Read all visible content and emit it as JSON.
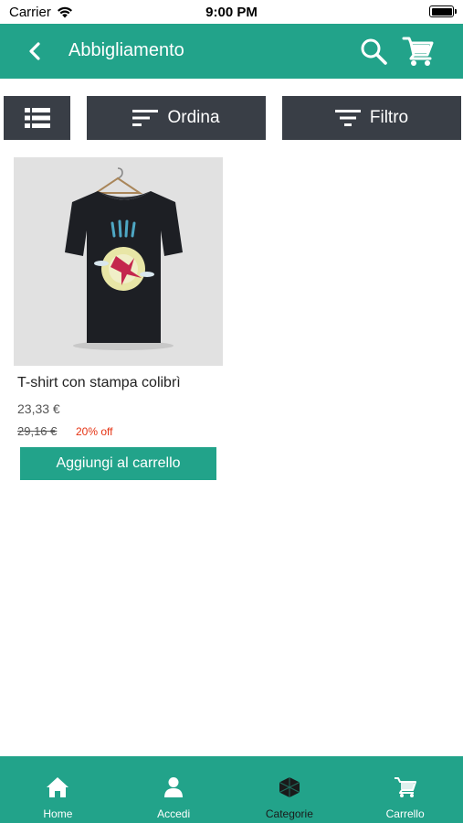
{
  "status_bar": {
    "carrier": "Carrier",
    "time": "9:00 PM"
  },
  "app_bar": {
    "title": "Abbigliamento",
    "back_icon": "chevron-left-icon",
    "search_icon": "search-icon",
    "cart_icon": "cart-icon"
  },
  "toolbar": {
    "view_icon": "list-view-icon",
    "sort_label": "Ordina",
    "filter_label": "Filtro"
  },
  "products": [
    {
      "name": "T-shirt con stampa colibrì",
      "price": "23,33 €",
      "old_price": "29,16 €",
      "discount": "20% off",
      "add_to_cart_label": "Aggiungi al carrello"
    }
  ],
  "bottom_nav": {
    "items": [
      {
        "label": "Home",
        "icon": "home-icon"
      },
      {
        "label": "Accedi",
        "icon": "user-icon"
      },
      {
        "label": "Categorie",
        "icon": "cube-icon",
        "active": true
      },
      {
        "label": "Carrello",
        "icon": "cart-icon"
      }
    ]
  },
  "colors": {
    "primary": "#22a38a",
    "toolbar": "#393e46",
    "discount": "#e53212"
  }
}
